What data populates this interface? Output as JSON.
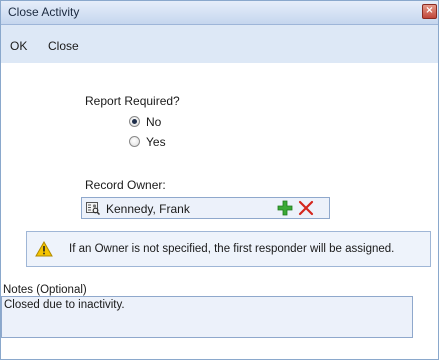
{
  "window": {
    "title": "Close Activity",
    "close_glyph": "×"
  },
  "toolbar": {
    "ok_label": "OK",
    "close_label": "Close"
  },
  "report": {
    "label": "Report Required?",
    "options": [
      {
        "label": "No",
        "checked": true
      },
      {
        "label": "Yes",
        "checked": false
      }
    ]
  },
  "owner": {
    "label": "Record Owner:",
    "value": "Kennedy, Frank",
    "icons": {
      "lookup": "address-card-icon",
      "add": "green-plus-icon",
      "remove": "red-x-icon"
    }
  },
  "warning": {
    "icon": "warning-triangle-icon",
    "text": "If an Owner is not specified, the first responder will be assigned."
  },
  "notes": {
    "label": "Notes (Optional)",
    "value": "Closed due to inactivity."
  },
  "colors": {
    "titlebar": "#c5d6ee",
    "toolbar": "#dde8f6",
    "field_bg": "#ecf1fa",
    "border": "#8fa8cc",
    "add_green": "#3aa935",
    "remove_red": "#d4271e",
    "warning_yellow": "#f5c400"
  }
}
